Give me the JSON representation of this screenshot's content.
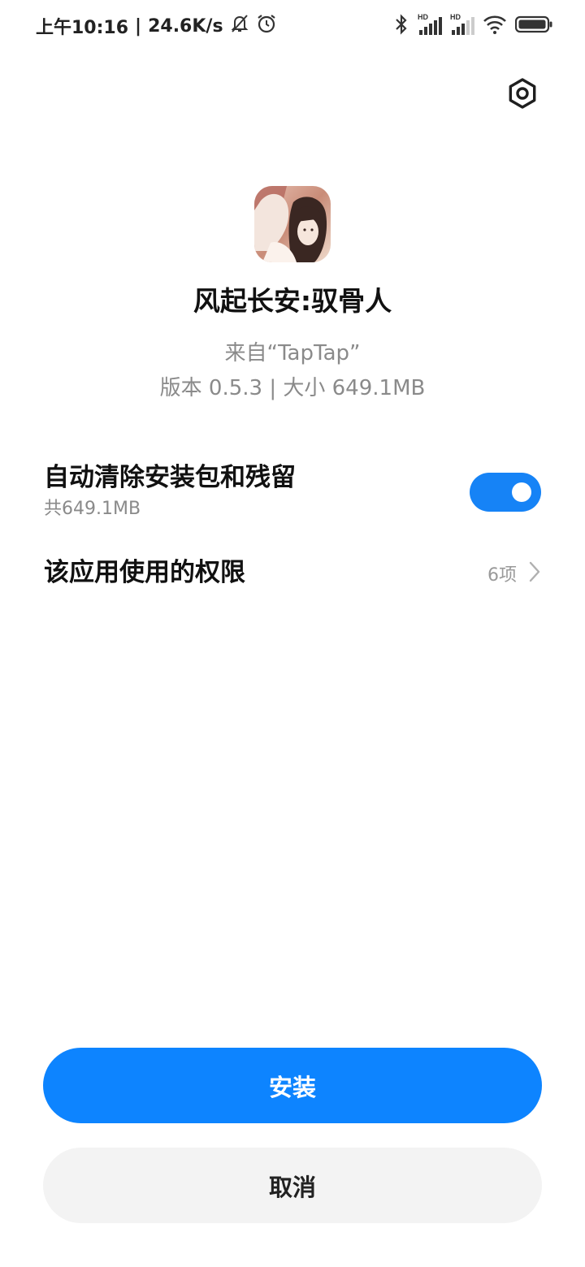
{
  "status_bar": {
    "time": "上午10:16",
    "separator": "|",
    "speed": "24.6K/s",
    "icons": [
      "mute-bell-icon",
      "alarm-icon",
      "bluetooth-icon",
      "signal-hd-icon",
      "signal-hd-icon",
      "wifi-icon",
      "battery-icon"
    ],
    "signal_tag_1": "HD",
    "signal_tag_2": "HD"
  },
  "app": {
    "name": "风起长安:驭骨人",
    "source": "来自“TapTap”",
    "version_size": "版本 0.5.3 | 大小 649.1MB"
  },
  "options": {
    "cleanup_title": "自动清除安装包和残留",
    "cleanup_sub": "共649.1MB",
    "cleanup_enabled": true,
    "permissions_title": "该应用使用的权限",
    "permissions_count": "6项"
  },
  "buttons": {
    "install": "安装",
    "cancel": "取消"
  },
  "colors": {
    "accent": "#0d84ff",
    "toggle_on": "#1683f6",
    "cancel_bg": "#f3f3f3",
    "secondary_text": "#8a8a8a"
  }
}
